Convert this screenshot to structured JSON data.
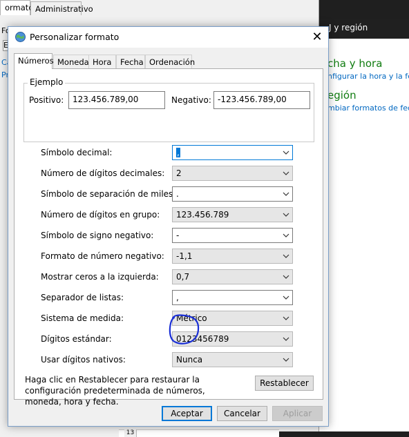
{
  "parent_window": {
    "tabs": [
      "ormatos",
      "Administrativo"
    ],
    "stub_labels": [
      "Fo",
      "E",
      "Ca",
      "Pr"
    ]
  },
  "right_window": {
    "title": "J y región",
    "section1_heading": "cha y hora",
    "section1_link": "nfigurar la hora y la fe",
    "section2_heading": "egión",
    "section2_link": "mbiar formatos de fec",
    "sheet_row": "13"
  },
  "dialog": {
    "title": "Personalizar formato",
    "tabs": [
      {
        "label": "Números",
        "selected": true
      },
      {
        "label": "Moneda",
        "selected": false
      },
      {
        "label": "Hora",
        "selected": false
      },
      {
        "label": "Fecha",
        "selected": false
      },
      {
        "label": "Ordenación",
        "selected": false
      }
    ],
    "example": {
      "legend": "Ejemplo",
      "positive_label": "Positivo:",
      "positive_value": "123.456.789,00",
      "negative_label": "Negativo:",
      "negative_value": "-123.456.789,00"
    },
    "settings": [
      {
        "label": "Símbolo decimal:",
        "value": ","
      },
      {
        "label": "Número de dígitos decimales:",
        "value": "2"
      },
      {
        "label": "Símbolo de separación de miles:",
        "value": "."
      },
      {
        "label": "Número de dígitos en grupo:",
        "value": "123.456.789"
      },
      {
        "label": "Símbolo de signo negativo:",
        "value": "-"
      },
      {
        "label": "Formato de número negativo:",
        "value": "-1,1"
      },
      {
        "label": "Mostrar ceros a la izquierda:",
        "value": "0,7"
      },
      {
        "label": "Separador de listas:",
        "value": ","
      },
      {
        "label": "Sistema de medida:",
        "value": "Métrico"
      },
      {
        "label": "Dígitos estándar:",
        "value": "0123456789"
      },
      {
        "label": "Usar dígitos nativos:",
        "value": "Nunca"
      }
    ],
    "reset_note": "Haga clic en Restablecer para restaurar la configuración predeterminada de números, moneda, hora y fecha.",
    "reset_button": "Restablecer",
    "ok_button": "Aceptar",
    "cancel_button": "Cancelar",
    "apply_button": "Aplicar"
  },
  "colors": {
    "accent": "#0078d7",
    "annotation_ink": "#1a2fd6",
    "green_heading": "#107c10"
  }
}
